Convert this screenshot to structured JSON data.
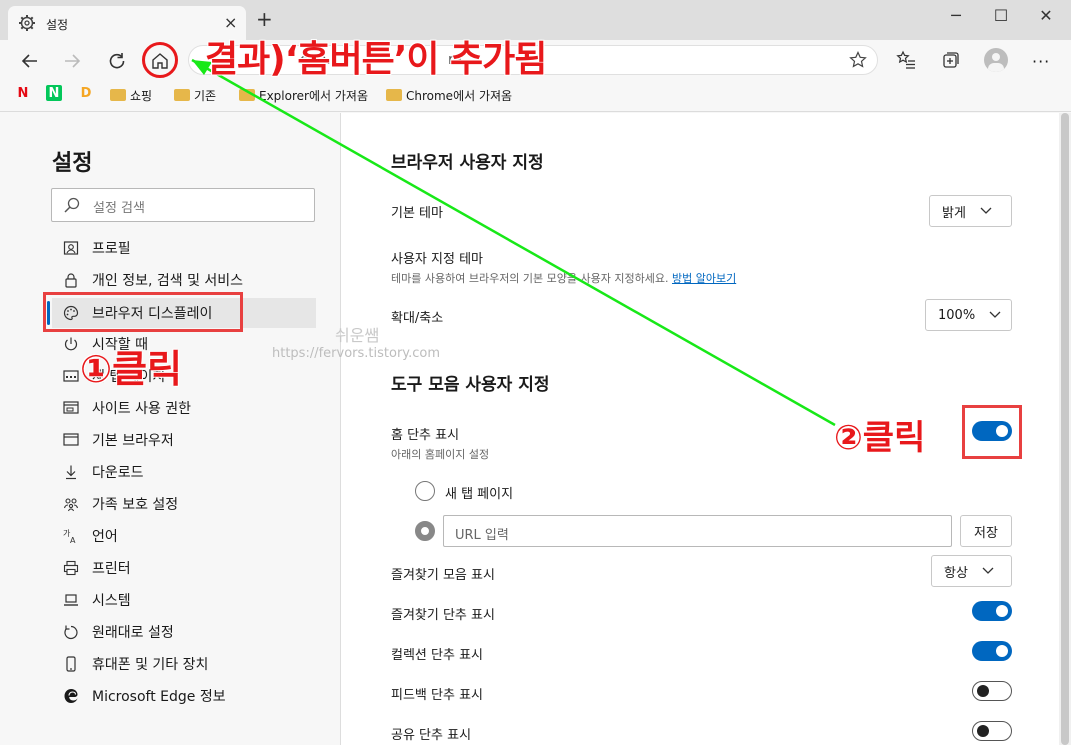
{
  "tab": {
    "title": "설정",
    "close": "×",
    "new": "+"
  },
  "window": {
    "minimize": "─",
    "maximize": "☐",
    "close": "✕"
  },
  "address": {
    "value": "edge://settings/appearance",
    "visible_fragment": "dge.",
    "visible_fragment2": "ra"
  },
  "bookmarks": [
    {
      "label": "쇼핑"
    },
    {
      "label": "기존"
    },
    {
      "label": "Explorer에서 가져옴"
    },
    {
      "label": "Chrome에서 가져옴"
    }
  ],
  "sidebar": {
    "title": "설정",
    "search_placeholder": "설정 검색",
    "items": [
      {
        "label": "프로필",
        "icon": "profile-icon"
      },
      {
        "label": "개인 정보, 검색 및 서비스",
        "icon": "lock-icon"
      },
      {
        "label": "브라우저 디스플레이",
        "icon": "palette-icon",
        "active": true
      },
      {
        "label": "시작할 때",
        "icon": "power-icon"
      },
      {
        "label": "새 탭 페이지",
        "icon": "newtab-icon"
      },
      {
        "label": "사이트 사용 권한",
        "icon": "site-permissions-icon"
      },
      {
        "label": "기본 브라우저",
        "icon": "browser-icon"
      },
      {
        "label": "다운로드",
        "icon": "download-icon"
      },
      {
        "label": "가족 보호 설정",
        "icon": "family-icon"
      },
      {
        "label": "언어",
        "icon": "language-icon"
      },
      {
        "label": "프린터",
        "icon": "printer-icon"
      },
      {
        "label": "시스템",
        "icon": "system-icon"
      },
      {
        "label": "원래대로 설정",
        "icon": "reset-icon"
      },
      {
        "label": "휴대폰 및 기타 장치",
        "icon": "phone-icon"
      },
      {
        "label": "Microsoft Edge 정보",
        "icon": "edge-icon"
      }
    ]
  },
  "content": {
    "section1": "브라우저 사용자 지정",
    "basic_theme": {
      "label": "기본 테마",
      "value": "밝게"
    },
    "custom_theme": {
      "label": "사용자 지정 테마",
      "desc": "테마를 사용하여 브라우저의 기본 모양을 사용자 지정하세요.",
      "link": "방법 알아보기"
    },
    "zoom": {
      "label": "확대/축소",
      "value": "100%"
    },
    "section2": "도구 모음 사용자 지정",
    "home": {
      "label": "홈 단추 표시",
      "sub": "아래의 홈페이지 설정",
      "on": true
    },
    "radio_newtab": "새 탭 페이지",
    "url_placeholder": "URL 입력",
    "save": "저장",
    "favbar": {
      "label": "즐겨찾기 모음 표시",
      "value": "항상"
    },
    "toggles": [
      {
        "label": "즐겨찾기 단추 표시",
        "on": true
      },
      {
        "label": "컬렉션 단추 표시",
        "on": true
      },
      {
        "label": "피드백 단추 표시",
        "on": false
      },
      {
        "label": "공유 단추 표시",
        "on": false
      }
    ]
  },
  "annotations": {
    "result": "결과)‘홈버튼’이 추가됨",
    "click1": "①클릭",
    "click2": "②클릭",
    "watermark": "쉬운쌤",
    "watermark_url": "https://fervors.tistory.com",
    "colors": {
      "red": "#e8181b",
      "green": "#18e818"
    }
  }
}
